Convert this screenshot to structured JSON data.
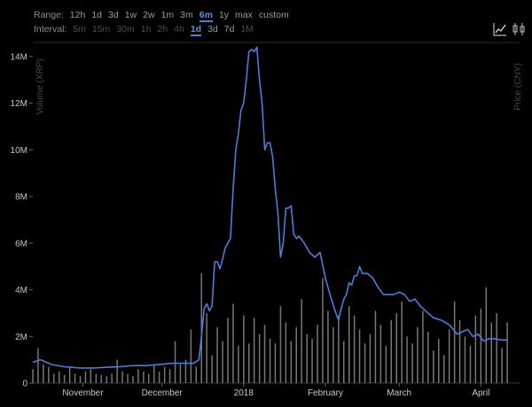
{
  "toolbar": {
    "range_label": "Range:",
    "range_options": [
      "12h",
      "1d",
      "3d",
      "1w",
      "2w",
      "1m",
      "3m",
      "6m",
      "1y",
      "max",
      "custom"
    ],
    "range_active": "6m",
    "interval_label": "Interval:",
    "interval_options": [
      "5m",
      "15m",
      "30m",
      "1h",
      "2h",
      "4h",
      "1d",
      "3d",
      "7d",
      "1M"
    ],
    "interval_active": "1d",
    "interval_enabled": [
      "1d",
      "3d",
      "7d"
    ],
    "icons": [
      "line-chart-icon",
      "candlestick-icon"
    ]
  },
  "colors": {
    "price_line": "#4a7fd8",
    "volume_bar": "#777777",
    "active": "#5b8ee6",
    "background": "#000000"
  },
  "chart_data": {
    "type": "line",
    "title": "",
    "ylabel_left": "Volume (XRP)",
    "ylabel_right": "Price (CNY)",
    "x_tick_labels": [
      "November",
      "December",
      "2018",
      "February",
      "March",
      "April"
    ],
    "y_tick_labels": [
      "0",
      "2M",
      "4M",
      "6M",
      "8M",
      "10M",
      "12M",
      "14M"
    ],
    "ylim": [
      0,
      14600000
    ],
    "x_range": [
      "2017-10-13",
      "2018-04-13"
    ],
    "x_ticks": [
      "2017-11-01",
      "2017-12-01",
      "2018-01-01",
      "2018-02-01",
      "2018-03-01",
      "2018-04-01"
    ],
    "series": [
      {
        "type": "line",
        "x": [
          "2017-10-13",
          "2017-10-16",
          "2017-10-20",
          "2017-10-25",
          "2017-10-31",
          "2017-11-05",
          "2017-11-10",
          "2017-11-15",
          "2017-11-20",
          "2017-11-25",
          "2017-11-30",
          "2017-12-05",
          "2017-12-10",
          "2017-12-13",
          "2017-12-15",
          "2017-12-16",
          "2017-12-17",
          "2017-12-18",
          "2017-12-19",
          "2017-12-20",
          "2017-12-21",
          "2017-12-22",
          "2017-12-23",
          "2017-12-24",
          "2017-12-25",
          "2017-12-26",
          "2017-12-27",
          "2017-12-28",
          "2017-12-29",
          "2017-12-30",
          "2017-12-31",
          "2018-01-01",
          "2018-01-02",
          "2018-01-03",
          "2018-01-04",
          "2018-01-05",
          "2018-01-06",
          "2018-01-07",
          "2018-01-08",
          "2018-01-09",
          "2018-01-10",
          "2018-01-11",
          "2018-01-12",
          "2018-01-13",
          "2018-01-14",
          "2018-01-15",
          "2018-01-16",
          "2018-01-17",
          "2018-01-18",
          "2018-01-19",
          "2018-01-20",
          "2018-01-21",
          "2018-01-22",
          "2018-01-24",
          "2018-01-26",
          "2018-01-28",
          "2018-01-30",
          "2018-02-01",
          "2018-02-03",
          "2018-02-05",
          "2018-02-06",
          "2018-02-07",
          "2018-02-08",
          "2018-02-09",
          "2018-02-10",
          "2018-02-11",
          "2018-02-12",
          "2018-02-13",
          "2018-02-14",
          "2018-02-15",
          "2018-02-17",
          "2018-02-19",
          "2018-02-21",
          "2018-02-23",
          "2018-02-25",
          "2018-02-27",
          "2018-03-01",
          "2018-03-03",
          "2018-03-05",
          "2018-03-07",
          "2018-03-09",
          "2018-03-11",
          "2018-03-14",
          "2018-03-17",
          "2018-03-20",
          "2018-03-23",
          "2018-03-25",
          "2018-03-27",
          "2018-03-29",
          "2018-03-31",
          "2018-04-02",
          "2018-04-04",
          "2018-04-06",
          "2018-04-09",
          "2018-04-11"
        ],
        "values": [
          900000,
          1000000,
          800000,
          700000,
          650000,
          650000,
          680000,
          700000,
          750000,
          750000,
          800000,
          850000,
          850000,
          850000,
          1000000,
          2000000,
          3200000,
          3400000,
          3100000,
          3300000,
          5200000,
          5200000,
          4900000,
          5300000,
          5800000,
          6000000,
          6200000,
          8300000,
          10000000,
          10700000,
          11700000,
          12000000,
          13000000,
          14200000,
          14300000,
          14200000,
          14400000,
          13000000,
          12000000,
          10000000,
          10300000,
          10300000,
          9700000,
          8300000,
          7300000,
          5400000,
          6000000,
          7500000,
          7500000,
          7600000,
          6400000,
          6200000,
          6300000,
          6000000,
          5600000,
          5400000,
          5600000,
          4500000,
          3700000,
          3000000,
          2700000,
          3200000,
          3600000,
          3800000,
          4300000,
          4200000,
          4600000,
          4600000,
          5000000,
          4700000,
          4700000,
          4500000,
          4100000,
          3800000,
          3800000,
          3800000,
          3900000,
          3800000,
          3500000,
          3600000,
          3300000,
          3100000,
          2800000,
          2700000,
          2500000,
          2100000,
          2200000,
          2300000,
          2000000,
          2100000,
          1800000,
          1900000,
          1900000,
          1850000,
          1850000
        ]
      },
      {
        "type": "bar",
        "x": [
          "2017-10-13",
          "2017-10-15",
          "2017-10-17",
          "2017-10-19",
          "2017-10-21",
          "2017-10-23",
          "2017-10-25",
          "2017-10-27",
          "2017-10-29",
          "2017-10-31",
          "2017-11-02",
          "2017-11-04",
          "2017-11-06",
          "2017-11-08",
          "2017-11-10",
          "2017-11-12",
          "2017-11-14",
          "2017-11-16",
          "2017-11-18",
          "2017-11-20",
          "2017-11-22",
          "2017-11-24",
          "2017-11-26",
          "2017-11-28",
          "2017-11-30",
          "2017-12-02",
          "2017-12-04",
          "2017-12-06",
          "2017-12-08",
          "2017-12-10",
          "2017-12-12",
          "2017-12-14",
          "2017-12-16",
          "2017-12-18",
          "2017-12-20",
          "2017-12-22",
          "2017-12-24",
          "2017-12-26",
          "2017-12-28",
          "2017-12-30",
          "2018-01-01",
          "2018-01-03",
          "2018-01-05",
          "2018-01-07",
          "2018-01-09",
          "2018-01-11",
          "2018-01-13",
          "2018-01-15",
          "2018-01-17",
          "2018-01-19",
          "2018-01-21",
          "2018-01-23",
          "2018-01-25",
          "2018-01-27",
          "2018-01-29",
          "2018-01-31",
          "2018-02-02",
          "2018-02-04",
          "2018-02-06",
          "2018-02-08",
          "2018-02-10",
          "2018-02-12",
          "2018-02-14",
          "2018-02-16",
          "2018-02-18",
          "2018-02-20",
          "2018-02-22",
          "2018-02-24",
          "2018-02-26",
          "2018-02-28",
          "2018-03-02",
          "2018-03-04",
          "2018-03-06",
          "2018-03-08",
          "2018-03-10",
          "2018-03-12",
          "2018-03-14",
          "2018-03-16",
          "2018-03-18",
          "2018-03-20",
          "2018-03-22",
          "2018-03-24",
          "2018-03-26",
          "2018-03-28",
          "2018-03-30",
          "2018-04-01",
          "2018-04-03",
          "2018-04-05",
          "2018-04-07",
          "2018-04-09",
          "2018-04-11"
        ],
        "values": [
          600000,
          1500000,
          800000,
          700000,
          400000,
          500000,
          350000,
          700000,
          400000,
          300000,
          500000,
          600000,
          400000,
          350000,
          300000,
          400000,
          1000000,
          500000,
          400000,
          300000,
          600000,
          500000,
          400000,
          800000,
          500000,
          700000,
          600000,
          1800000,
          800000,
          1000000,
          2300000,
          700000,
          4700000,
          3000000,
          1200000,
          2400000,
          1800000,
          2800000,
          3400000,
          1600000,
          2900000,
          1700000,
          2800000,
          2100000,
          2500000,
          1900000,
          1700000,
          3300000,
          2600000,
          1800000,
          2400000,
          3600000,
          2100000,
          1900000,
          2500000,
          4500000,
          3100000,
          2400000,
          2900000,
          1800000,
          3300000,
          2900000,
          2300000,
          1700000,
          2100000,
          3100000,
          2500000,
          1600000,
          2700000,
          3000000,
          3500000,
          2000000,
          1700000,
          2400000,
          3100000,
          2200000,
          1400000,
          1900000,
          1200000,
          2300000,
          3500000,
          2700000,
          2000000,
          1600000,
          2900000,
          3200000,
          4100000,
          2600000,
          3000000,
          1500000,
          2600000
        ]
      }
    ],
    "grid": false,
    "legend": "none"
  }
}
